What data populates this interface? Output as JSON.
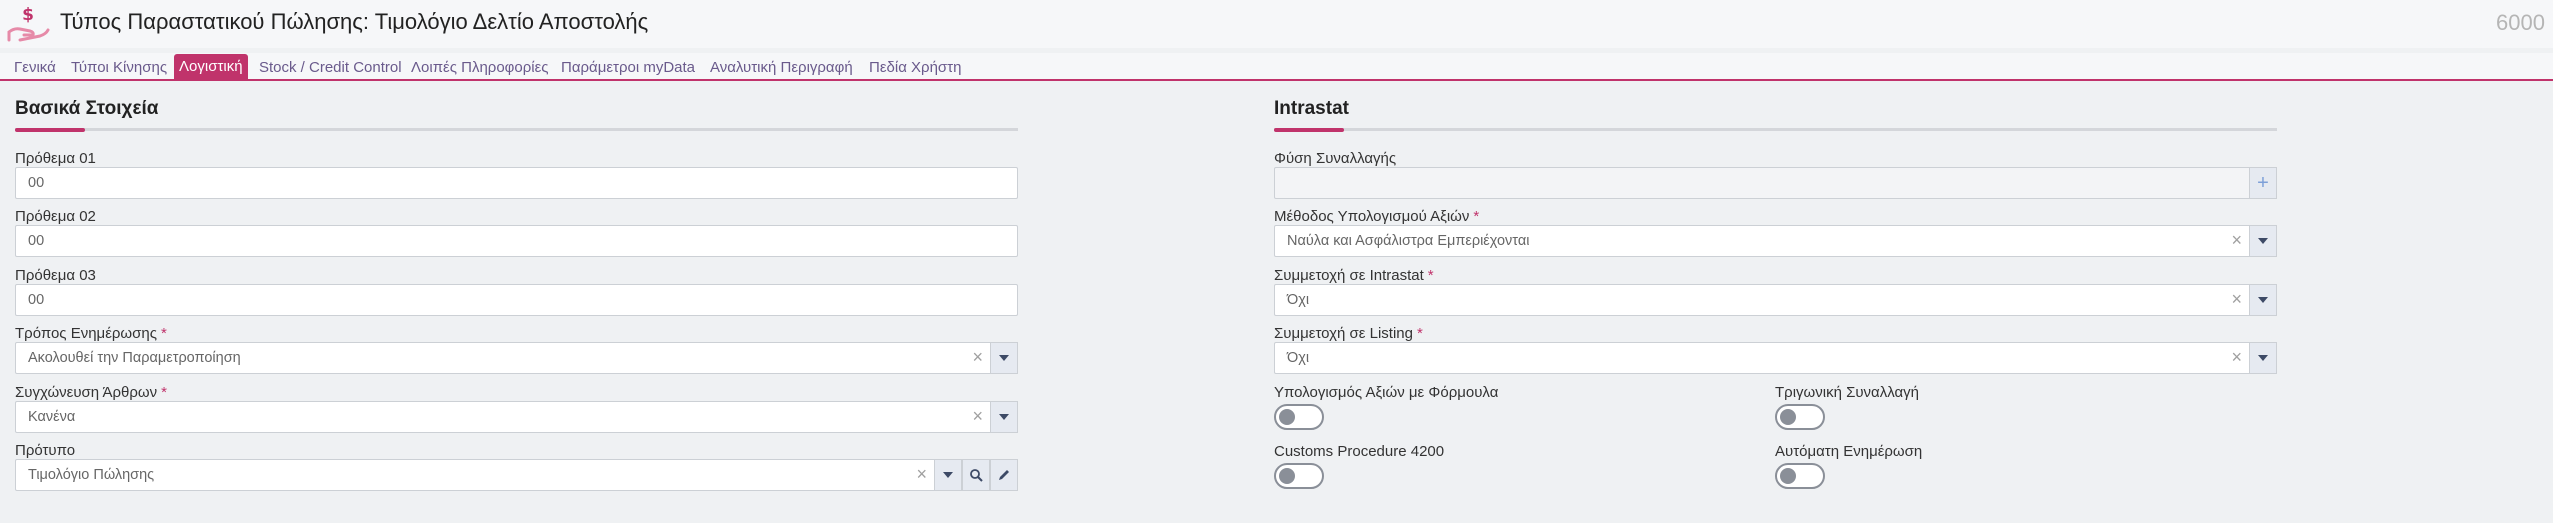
{
  "header": {
    "title": "Τύπος Παραστατικού Πώλησης: Τιμολόγιο Δελτίο Αποστολής",
    "record_number": "6000"
  },
  "tabs": [
    {
      "label": "Γενικά",
      "active": false
    },
    {
      "label": "Τύποι Κίνησης",
      "active": false
    },
    {
      "label": "Λογιστική",
      "active": true
    },
    {
      "label": "Stock / Credit Control",
      "active": false
    },
    {
      "label": "Λοιπές Πληροφορίες",
      "active": false
    },
    {
      "label": "Παράμετροι myData",
      "active": false
    },
    {
      "label": "Αναλυτική Περιγραφή",
      "active": false
    },
    {
      "label": "Πεδία Χρήστη",
      "active": false
    }
  ],
  "basic": {
    "title": "Βασικά Στοιχεία",
    "prefix1": {
      "label": "Πρόθεμα 01",
      "value": "00"
    },
    "prefix2": {
      "label": "Πρόθεμα 02",
      "value": "00"
    },
    "prefix3": {
      "label": "Πρόθεμα 03",
      "value": "00"
    },
    "update_mode": {
      "label": "Τρόπος Ενημέρωσης",
      "required": "*",
      "value": "Ακολουθεί την Παραμετροποίηση"
    },
    "merge_items": {
      "label": "Συγχώνευση Άρθρων",
      "required": "*",
      "value": "Κανένα"
    },
    "template": {
      "label": "Πρότυπο",
      "value": "Τιμολόγιο Πώλησης"
    }
  },
  "intrastat": {
    "title": "Intrastat",
    "transaction_nature": {
      "label": "Φύση Συναλλαγής",
      "value": ""
    },
    "value_method": {
      "label": "Μέθοδος Υπολογισμού Αξιών",
      "required": "*",
      "value": "Ναύλα και Ασφάλιστρα Εμπεριέχονται"
    },
    "intrastat_participation": {
      "label": "Συμμετοχή σε Intrastat",
      "required": "*",
      "value": "Όχι"
    },
    "listing_participation": {
      "label": "Συμμετοχή σε Listing",
      "required": "*",
      "value": "Όχι"
    },
    "formula_calc": {
      "label": "Υπολογισμός Αξιών με Φόρμουλα",
      "on": false
    },
    "triangular": {
      "label": "Τριγωνική Συναλλαγή",
      "on": false
    },
    "customs": {
      "label": "Customs Procedure 4200",
      "on": false
    },
    "auto_update": {
      "label": "Αυτόματη Ενημέρωση",
      "on": false
    }
  },
  "colors": {
    "accent": "#c0336b",
    "tab_text": "#6a5a8c",
    "background": "#eff1f3"
  },
  "icons": [
    "money-hand-icon",
    "clear-icon",
    "chevron-down-icon",
    "search-icon",
    "pencil-icon",
    "plus-icon"
  ]
}
